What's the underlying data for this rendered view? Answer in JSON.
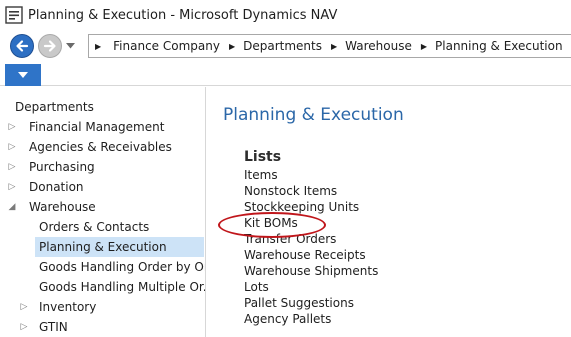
{
  "window": {
    "title": "Planning & Execution - Microsoft Dynamics NAV"
  },
  "breadcrumb": [
    "Finance Company",
    "Departments",
    "Warehouse",
    "Planning & Execution"
  ],
  "navpane": {
    "items": [
      {
        "label": "Departments",
        "arrow": "",
        "selected": false
      },
      {
        "label": "Financial Management",
        "arrow": "▷",
        "selected": false
      },
      {
        "label": "Agencies & Receivables",
        "arrow": "▷",
        "selected": false
      },
      {
        "label": "Purchasing",
        "arrow": "▷",
        "selected": false
      },
      {
        "label": "Donation",
        "arrow": "▷",
        "selected": false
      },
      {
        "label": "Warehouse",
        "arrow": "◢",
        "selected": false
      },
      {
        "label": "Orders & Contacts",
        "arrow": "",
        "selected": false
      },
      {
        "label": "Planning & Execution",
        "arrow": "",
        "selected": true
      },
      {
        "label": "Goods Handling Order by Or...",
        "arrow": "",
        "selected": false
      },
      {
        "label": "Goods Handling Multiple Or...",
        "arrow": "",
        "selected": false
      },
      {
        "label": "Inventory",
        "arrow": "▷",
        "selected": false
      },
      {
        "label": "GTIN",
        "arrow": "▷",
        "selected": false
      }
    ]
  },
  "main": {
    "title": "Planning & Execution",
    "section": "Lists",
    "links": [
      "Items",
      "Nonstock Items",
      "Stockkeeping Units",
      "Kit BOMs",
      "Transfer Orders",
      "Warehouse Receipts",
      "Warehouse Shipments",
      "Lots",
      "Pallet Suggestions",
      "Agency Pallets"
    ]
  },
  "colors": {
    "accent": "#2f74c8",
    "title_blue": "#2b67a8",
    "selection": "#cde3f7",
    "annotation": "#c0161b"
  },
  "icons": {
    "app": "dynamics-nav-icon",
    "back": "back-arrow-icon",
    "forward": "forward-arrow-icon",
    "dropdown": "chevron-down-icon"
  }
}
